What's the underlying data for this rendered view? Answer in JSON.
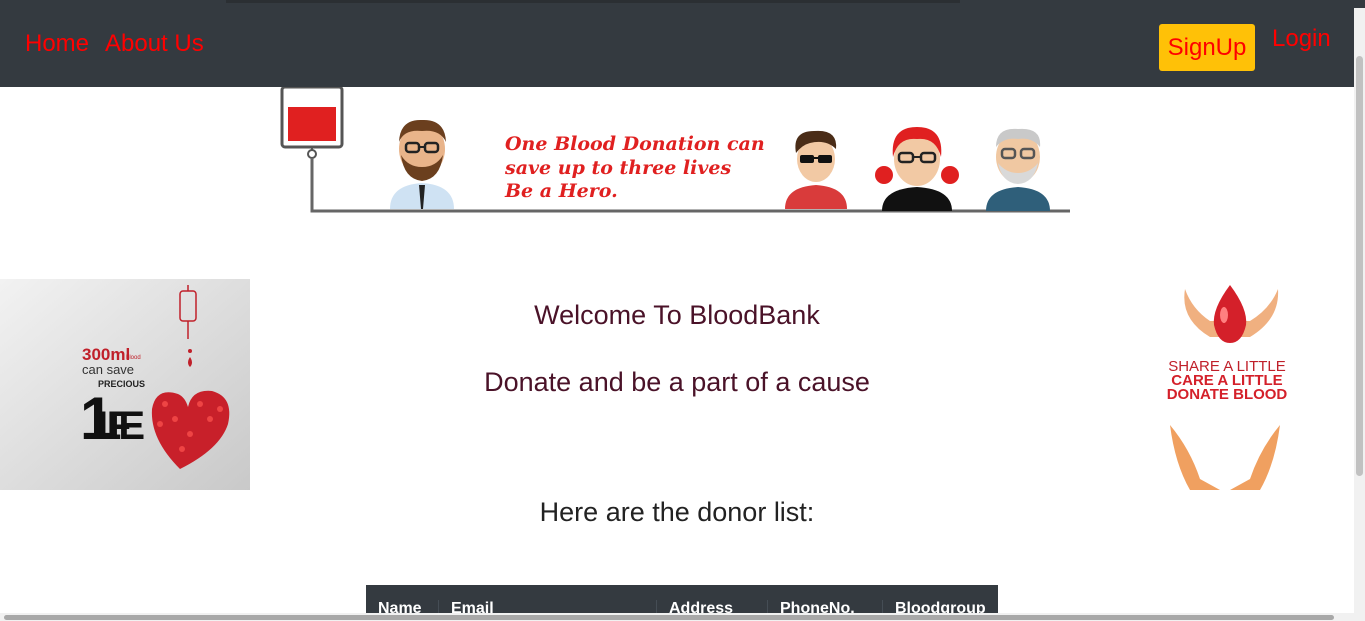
{
  "nav": {
    "home": "Home",
    "about": "About Us",
    "signup": "SignUp",
    "login": "Login"
  },
  "banner": {
    "line1": "One Blood Donation can",
    "line2": "save up to three lives",
    "line3": "Be a Hero."
  },
  "left_image": {
    "volume": "300ml",
    "unit": "blood",
    "can_save": "can save",
    "precious": "PRECIOUS",
    "number": "1",
    "life": "LIFE"
  },
  "right_image": {
    "line1": "SHARE A LITTLE",
    "line2": "CARE A LITTLE",
    "line3": "DONATE BLOOD"
  },
  "main": {
    "welcome": "Welcome To BloodBank",
    "tagline": "Donate and be a part of a cause",
    "donor_heading": "Here are the donor list:"
  },
  "table": {
    "headers": [
      "Name",
      "Email",
      "Address",
      "PhoneNo.",
      "Bloodgroup"
    ]
  },
  "colors": {
    "navbar": "#343a40",
    "link": "#ff0000",
    "signup_bg": "#ffc107",
    "heading": "#4a1228",
    "blood_red": "#e02020"
  }
}
